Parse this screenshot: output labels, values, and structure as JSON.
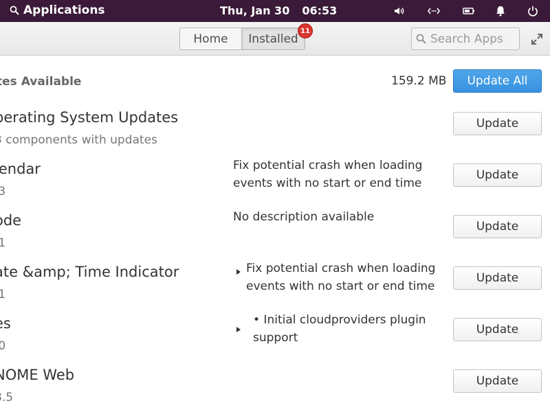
{
  "panel": {
    "applications_label": "Applications",
    "date": "Thu, Jan 30",
    "time": "06:53"
  },
  "header": {
    "tabs": [
      {
        "label": "Home"
      },
      {
        "label": "Installed",
        "badge": "11"
      }
    ],
    "search_placeholder": "Search Apps"
  },
  "summary": {
    "title": "tes Available",
    "size": "159.2 MB",
    "update_all_label": "Update All"
  },
  "updates": [
    {
      "name": "perating System Updates",
      "sub": "3 components with updates",
      "desc": "",
      "button": "Update"
    },
    {
      "name": "lendar",
      "sub": ".3",
      "desc": "Fix potential crash when loading events with no start or end time",
      "button": "Update"
    },
    {
      "name": "ode",
      "sub": ".1",
      "desc": "No description available",
      "button": "Update"
    },
    {
      "name": "ate &amp; Time Indicator",
      "sub": ".1",
      "desc": "Fix potential crash when loading events with no start or end time",
      "button": "Update"
    },
    {
      "name": "es",
      "sub": ".0",
      "desc": "• Initial cloudproviders plugin support",
      "button": "Update"
    },
    {
      "name": "NOME Web",
      "sub": "8.5",
      "desc": "",
      "button": "Update"
    }
  ],
  "colors": {
    "panel_bg": "#3a1a38",
    "accent": "#3892e0",
    "badge": "#d9362f"
  }
}
